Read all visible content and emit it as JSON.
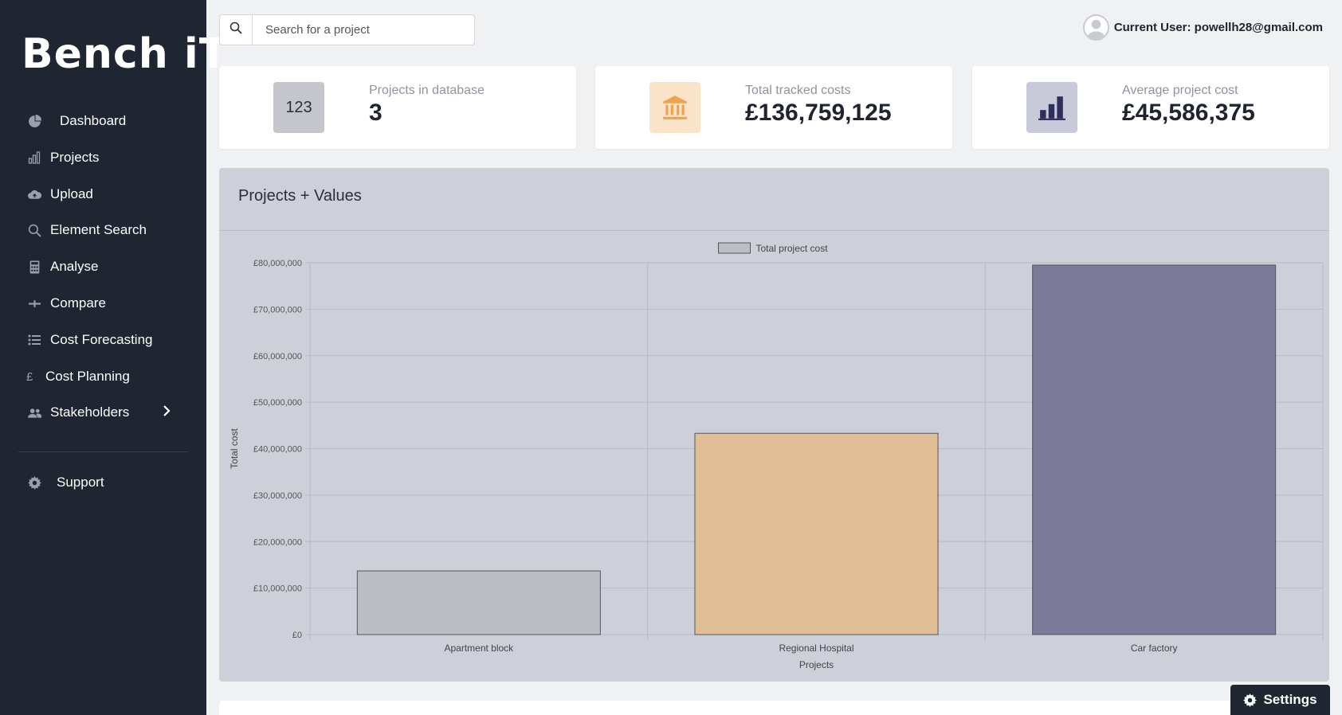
{
  "app": {
    "logo": "Bench iT",
    "accent": "#1f2531"
  },
  "sidebar": {
    "items": [
      {
        "label": "Dashboard",
        "icon": "pie-chart-icon"
      },
      {
        "label": "Projects",
        "icon": "building-chart-icon"
      },
      {
        "label": "Upload",
        "icon": "cloud-upload-icon"
      },
      {
        "label": "Element Search",
        "icon": "search-icon"
      },
      {
        "label": "Analyse",
        "icon": "calculator-icon"
      },
      {
        "label": "Compare",
        "icon": "compare-icon"
      },
      {
        "label": "Cost Forecasting",
        "icon": "list-icon"
      },
      {
        "label": "Cost Planning",
        "icon": "pound-icon"
      },
      {
        "label": "Stakeholders",
        "icon": "users-icon"
      }
    ],
    "support": {
      "label": "Support",
      "icon": "gear-icon"
    }
  },
  "search": {
    "placeholder": "Search for a project"
  },
  "user": {
    "label": "Current User: powellh28@gmail.com"
  },
  "stats": [
    {
      "badge": "123",
      "label": "Projects in database",
      "value": "3",
      "badge_color": "#c4c6cb"
    },
    {
      "badge": "",
      "label": "Total tracked costs",
      "value": "£136,759,125",
      "badge_color": "#fbe3c9",
      "icon": "bank-icon"
    },
    {
      "badge": "",
      "label": "Average project cost",
      "value": "£45,586,375",
      "badge_color": "#c9cad8",
      "icon": "bar-chart-icon"
    }
  ],
  "panel": {
    "title": "Projects + Values"
  },
  "chart_data": {
    "type": "bar",
    "categories": [
      "Apartment block",
      "Regional Hospital",
      "Car factory"
    ],
    "series": [
      {
        "name": "Total project cost",
        "values": [
          13700000,
          43300000,
          79500000
        ],
        "colors": [
          "#bcbec3",
          "#e0bf96",
          "#7b7b99"
        ]
      }
    ],
    "xlabel": "Projects",
    "ylabel": "Total cost",
    "ylim": [
      0,
      80000000
    ],
    "yticks": [
      "£0",
      "£10,000,000",
      "£20,000,000",
      "£30,000,000",
      "£40,000,000",
      "£50,000,000",
      "£60,000,000",
      "£70,000,000",
      "£80,000,000"
    ],
    "grid": true,
    "legend": "top-center"
  },
  "settings": {
    "label": "Settings"
  }
}
